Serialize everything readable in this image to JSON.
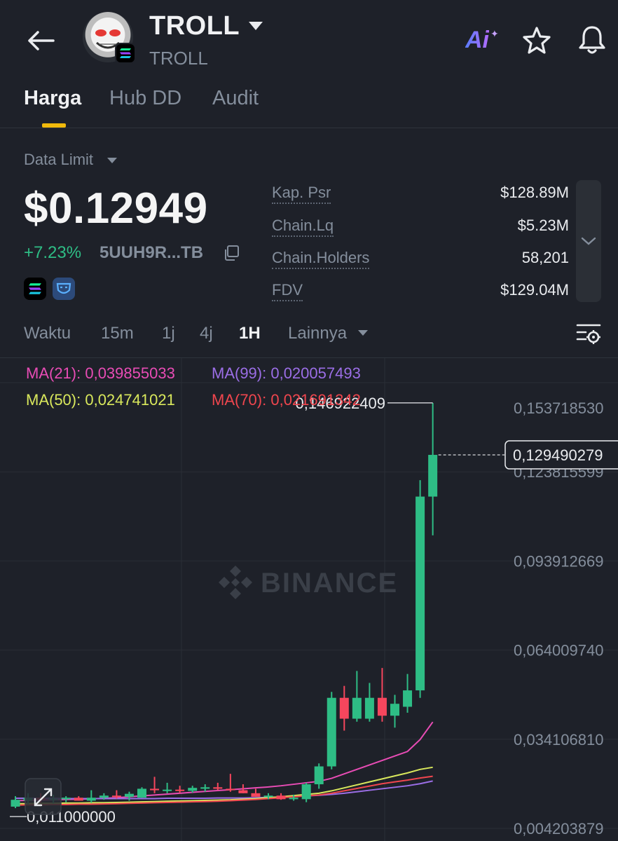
{
  "header": {
    "token_name": "TROLL",
    "token_symbol": "TROLL",
    "ai_label": "Ai",
    "icons": [
      "back-arrow-icon",
      "caret-down-icon",
      "star-icon",
      "bell-icon",
      "solana-icon"
    ]
  },
  "tabs": [
    {
      "label": "Harga",
      "active": true
    },
    {
      "label": "Hub DD",
      "active": false
    },
    {
      "label": "Audit",
      "active": false
    }
  ],
  "price_panel": {
    "data_source": "Data Limit",
    "price": "$0.12949",
    "change": "+7.23%",
    "address": "5UUH9R...TB",
    "stats": [
      {
        "label": "Kap. Psr",
        "value": "$128.89M"
      },
      {
        "label": "Chain.Lq",
        "value": "$5.23M"
      },
      {
        "label": "Chain.Holders",
        "value": "58,201"
      },
      {
        "label": "FDV",
        "value": "$129.04M"
      }
    ]
  },
  "intervals": {
    "label": "Waktu",
    "items": [
      {
        "label": "15m",
        "active": false
      },
      {
        "label": "1j",
        "active": false
      },
      {
        "label": "4j",
        "active": false
      },
      {
        "label": "1H",
        "active": true
      }
    ],
    "more": "Lainnya"
  },
  "colors": {
    "up": "#2ebd85",
    "down": "#f6465d",
    "accent": "#f0b90b",
    "ma21": "#e84cb5",
    "ma99": "#9b6ee6",
    "ma50": "#d9e85c",
    "ma70": "#f0464e"
  },
  "chart_data": {
    "type": "candlestick",
    "indicators": [
      {
        "name": "MA(21)",
        "value": "0,039855033",
        "color": "#e84cb5"
      },
      {
        "name": "MA(99)",
        "value": "0,020057493",
        "color": "#9b6ee6"
      },
      {
        "name": "MA(50)",
        "value": "0,024741021",
        "color": "#d9e85c"
      },
      {
        "name": "MA(70)",
        "value": "0,021691342",
        "color": "#f0464e"
      }
    ],
    "y_tick_labels": [
      "0,153718530",
      "0,123815599",
      "0,093912669",
      "0,064009740",
      "0,034106810",
      "0,004203879"
    ],
    "y_ticks": [
      0.15371853,
      0.123815599,
      0.093912669,
      0.06400974,
      0.03410681,
      0.004203879
    ],
    "ylim": [
      0.004203879,
      0.15371853
    ],
    "last_price_label": "0,129490279",
    "last_price": 0.129490279,
    "high_label": "0,146922409",
    "high": 0.146922409,
    "low_label": "0,011000000",
    "low": 0.011,
    "watermark": "BINANCE",
    "candles": [
      {
        "o": 0.0115,
        "h": 0.015,
        "l": 0.011,
        "c": 0.0138
      },
      {
        "o": 0.0135,
        "h": 0.016,
        "l": 0.0122,
        "c": 0.0145
      },
      {
        "o": 0.0145,
        "h": 0.016,
        "l": 0.0128,
        "c": 0.0138
      },
      {
        "o": 0.0138,
        "h": 0.0155,
        "l": 0.0126,
        "c": 0.0142
      },
      {
        "o": 0.014,
        "h": 0.015,
        "l": 0.013,
        "c": 0.0145
      },
      {
        "o": 0.0145,
        "h": 0.015,
        "l": 0.0135,
        "c": 0.0135
      },
      {
        "o": 0.0135,
        "h": 0.017,
        "l": 0.0128,
        "c": 0.0145
      },
      {
        "o": 0.0145,
        "h": 0.016,
        "l": 0.0138,
        "c": 0.0152
      },
      {
        "o": 0.0152,
        "h": 0.017,
        "l": 0.0142,
        "c": 0.0148
      },
      {
        "o": 0.0148,
        "h": 0.0165,
        "l": 0.0135,
        "c": 0.0158
      },
      {
        "o": 0.0145,
        "h": 0.018,
        "l": 0.0145,
        "c": 0.0175
      },
      {
        "o": 0.0175,
        "h": 0.0215,
        "l": 0.016,
        "c": 0.017
      },
      {
        "o": 0.017,
        "h": 0.0195,
        "l": 0.016,
        "c": 0.0172
      },
      {
        "o": 0.0172,
        "h": 0.0185,
        "l": 0.016,
        "c": 0.017
      },
      {
        "o": 0.0168,
        "h": 0.0185,
        "l": 0.0162,
        "c": 0.0178
      },
      {
        "o": 0.0175,
        "h": 0.019,
        "l": 0.0165,
        "c": 0.018
      },
      {
        "o": 0.018,
        "h": 0.0195,
        "l": 0.017,
        "c": 0.0175
      },
      {
        "o": 0.0175,
        "h": 0.0225,
        "l": 0.0165,
        "c": 0.017
      },
      {
        "o": 0.017,
        "h": 0.019,
        "l": 0.016,
        "c": 0.016
      },
      {
        "o": 0.016,
        "h": 0.0175,
        "l": 0.0148,
        "c": 0.0148
      },
      {
        "o": 0.0148,
        "h": 0.016,
        "l": 0.014,
        "c": 0.0152
      },
      {
        "o": 0.0152,
        "h": 0.016,
        "l": 0.0138,
        "c": 0.014
      },
      {
        "o": 0.014,
        "h": 0.0155,
        "l": 0.0135,
        "c": 0.0145
      },
      {
        "o": 0.014,
        "h": 0.0195,
        "l": 0.013,
        "c": 0.019
      },
      {
        "o": 0.019,
        "h": 0.026,
        "l": 0.0175,
        "c": 0.025
      },
      {
        "o": 0.025,
        "h": 0.05,
        "l": 0.024,
        "c": 0.048
      },
      {
        "o": 0.048,
        "h": 0.052,
        "l": 0.037,
        "c": 0.041
      },
      {
        "o": 0.041,
        "h": 0.057,
        "l": 0.04,
        "c": 0.048
      },
      {
        "o": 0.041,
        "h": 0.053,
        "l": 0.04,
        "c": 0.048
      },
      {
        "o": 0.048,
        "h": 0.058,
        "l": 0.04,
        "c": 0.042
      },
      {
        "o": 0.042,
        "h": 0.049,
        "l": 0.038,
        "c": 0.046
      },
      {
        "o": 0.045,
        "h": 0.056,
        "l": 0.043,
        "c": 0.0505
      },
      {
        "o": 0.0505,
        "h": 0.121,
        "l": 0.048,
        "c": 0.1155
      },
      {
        "o": 0.1155,
        "h": 0.1469,
        "l": 0.1025,
        "c": 0.1295
      }
    ],
    "moving_averages": [
      {
        "name": "MA(21)",
        "color": "#e84cb5",
        "values": [
          0.0135,
          0.0136,
          0.0137,
          0.0138,
          0.0139,
          0.014,
          0.0141,
          0.0143,
          0.0145,
          0.0148,
          0.0151,
          0.0154,
          0.0157,
          0.016,
          0.0163,
          0.0166,
          0.0169,
          0.0172,
          0.0175,
          0.0178,
          0.0181,
          0.0185,
          0.019,
          0.0195,
          0.02,
          0.021,
          0.0225,
          0.024,
          0.0255,
          0.027,
          0.0285,
          0.03,
          0.034,
          0.0399
        ]
      },
      {
        "name": "MA(99)",
        "color": "#9b6ee6",
        "values": [
          0.0143,
          0.0143,
          0.0143,
          0.0143,
          0.0142,
          0.0142,
          0.0142,
          0.0142,
          0.0142,
          0.0142,
          0.0142,
          0.0142,
          0.0143,
          0.0143,
          0.0143,
          0.0143,
          0.0144,
          0.0144,
          0.0144,
          0.0145,
          0.0146,
          0.0147,
          0.0149,
          0.0151,
          0.0153,
          0.0156,
          0.016,
          0.0165,
          0.017,
          0.0175,
          0.018,
          0.0185,
          0.0192,
          0.0201
        ]
      },
      {
        "name": "MA(50)",
        "color": "#d9e85c",
        "values": [
          0.0125,
          0.0125,
          0.0126,
          0.0126,
          0.0127,
          0.0127,
          0.0128,
          0.0128,
          0.0129,
          0.013,
          0.0131,
          0.0132,
          0.0133,
          0.0134,
          0.0135,
          0.0136,
          0.0137,
          0.0138,
          0.014,
          0.0142,
          0.0145,
          0.0148,
          0.0152,
          0.0156,
          0.016,
          0.0168,
          0.0178,
          0.0188,
          0.0198,
          0.0208,
          0.0218,
          0.0228,
          0.024,
          0.0247
        ]
      },
      {
        "name": "MA(70)",
        "color": "#f0464e",
        "values": [
          0.012,
          0.0121,
          0.0121,
          0.0122,
          0.0122,
          0.0123,
          0.0123,
          0.0124,
          0.0125,
          0.0126,
          0.0127,
          0.0128,
          0.0129,
          0.013,
          0.0131,
          0.0132,
          0.0133,
          0.0135,
          0.0137,
          0.0139,
          0.0142,
          0.0145,
          0.0148,
          0.0151,
          0.0154,
          0.016,
          0.0168,
          0.0176,
          0.0184,
          0.0192,
          0.0198,
          0.0204,
          0.0211,
          0.0217
        ]
      }
    ]
  }
}
